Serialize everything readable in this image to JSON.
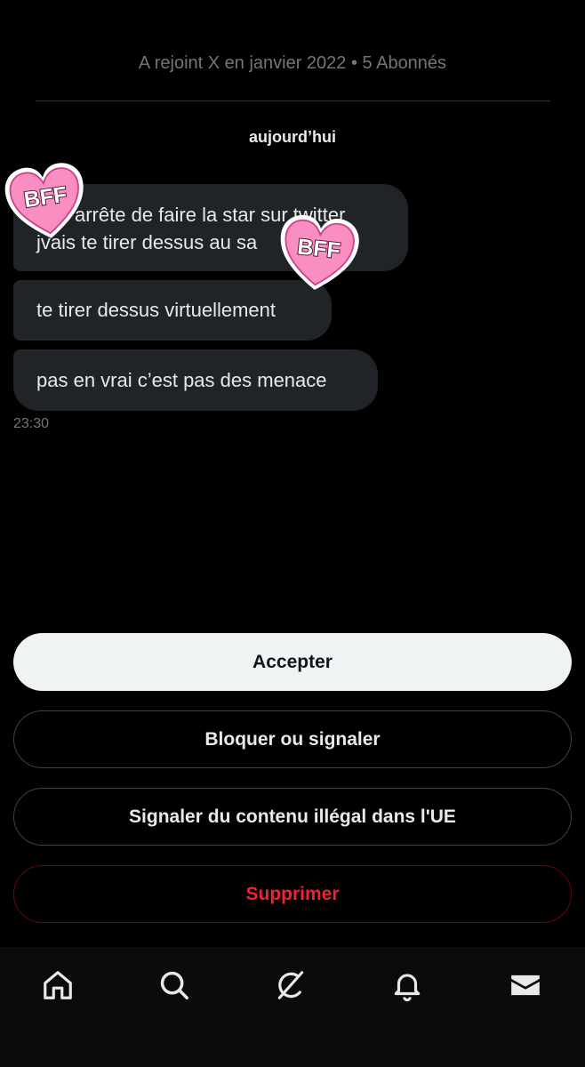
{
  "header": {
    "profile_meta": "A rejoint X en janvier 2022 • 5 Abonnés"
  },
  "conversation": {
    "date_label": "aujourd’hui",
    "messages": [
      {
        "lines": [
          "arrête de faire la star sur twitter",
          "jvais te tirer dessus au sa"
        ]
      },
      {
        "lines": [
          "te tirer dessus virtuellement"
        ]
      },
      {
        "lines": [
          "pas en vrai c’est pas des menace"
        ]
      }
    ],
    "timestamp": "23:30",
    "stickers": [
      {
        "text": "BFF",
        "color": "#f98ec3"
      },
      {
        "text": "BFF",
        "color": "#f98ec3"
      }
    ]
  },
  "actions": {
    "accept_label": "Accepter",
    "block_label": "Bloquer ou signaler",
    "report_label": "Signaler du contenu illégal dans l'UE",
    "delete_label": "Supprimer"
  },
  "nav": {
    "items": [
      {
        "icon": "home-icon"
      },
      {
        "icon": "search-icon"
      },
      {
        "icon": "grok-icon"
      },
      {
        "icon": "bell-icon"
      },
      {
        "icon": "mail-icon"
      }
    ]
  },
  "colors": {
    "background": "#000000",
    "bubble": "#202327",
    "danger": "#f4212e",
    "accept_bg": "#eff3f4",
    "sticker_pink": "#f98ec3"
  }
}
